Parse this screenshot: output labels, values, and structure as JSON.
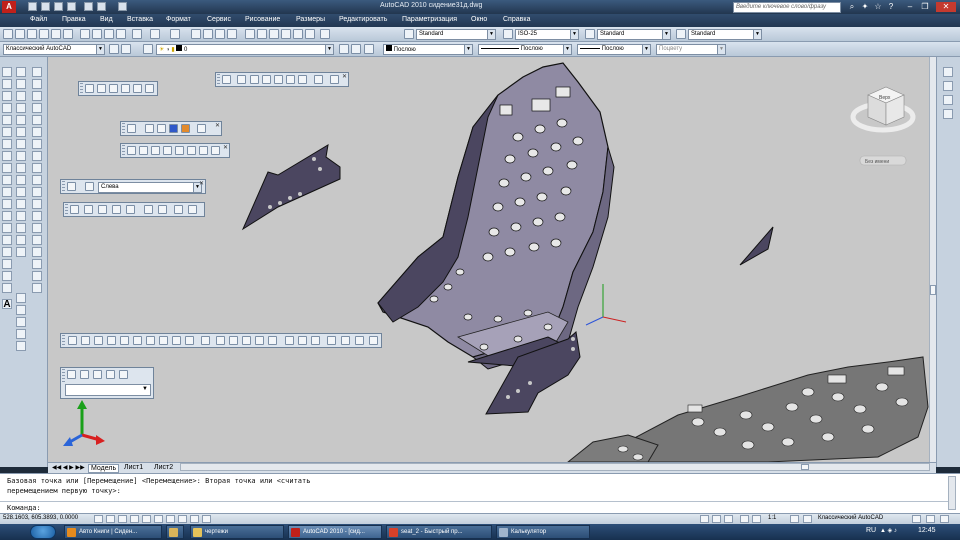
{
  "window": {
    "title": "AutoCAD 2010    сидение31д.dwg",
    "search_placeholder": "Введите ключевое слово/фразу"
  },
  "menu": [
    "Файл",
    "Правка",
    "Вид",
    "Вставка",
    "Формат",
    "Сервис",
    "Рисование",
    "Размеры",
    "Редактировать",
    "Параметризация",
    "Окно",
    "Справка"
  ],
  "toolbar": {
    "text_style": "Standard",
    "dim_style": "ISO-25",
    "table_style": "Standard",
    "multileader_style": "Standard",
    "workspace": "Классический AutoCAD",
    "layer": "0",
    "color": "Послою",
    "linetype": "Послою",
    "lineweight": "Послою",
    "plot_style": "Поцвету"
  },
  "view_toolbar": {
    "view_select": "Слева"
  },
  "viewcube": {
    "face_label": "Верх",
    "wcs_label": "Без имени"
  },
  "tabs": [
    "Модель",
    "Лист1",
    "Лист2"
  ],
  "command": {
    "history_1": "Базовая точка или [Перемещение] <Перемещение>: Вторая точка или <считать",
    "history_2": "перемещением первую точку>:",
    "prompt": "Команда:"
  },
  "status": {
    "coordinates": "528.1603, 605.3893, 0.0000",
    "scale": "1:1",
    "workspace": "Классический AutoCAD"
  },
  "taskbar": {
    "items": [
      "Авто Книги | Сиден...",
      "чертежи",
      "AutoCAD 2010 - [сид...",
      "seat_2 - Быстрый пр...",
      "Калькулятор"
    ],
    "lang": "RU",
    "time": "12:45"
  },
  "colors": {
    "titlebar": "#2a4466",
    "canvas": "#c8c8c8",
    "seat_dark": "#4b4660",
    "seat_light": "#8f8aa3",
    "panel_gray": "#767676"
  }
}
